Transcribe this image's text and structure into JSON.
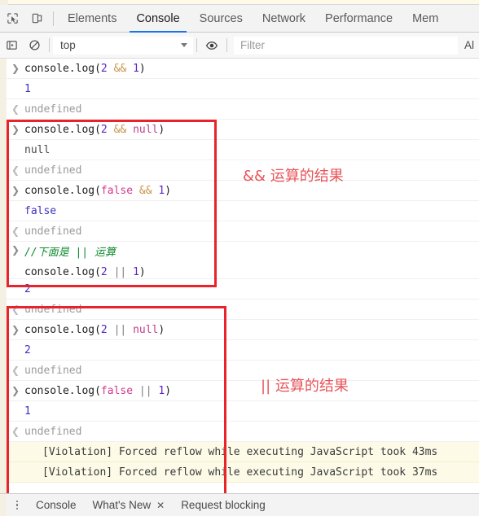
{
  "devtools": {
    "tabs": [
      {
        "label": "Elements",
        "active": false
      },
      {
        "label": "Console",
        "active": true
      },
      {
        "label": "Sources",
        "active": false
      },
      {
        "label": "Network",
        "active": false
      },
      {
        "label": "Performance",
        "active": false
      },
      {
        "label": "Mem",
        "active": false
      }
    ],
    "icons": {
      "inspect": "inspect-element-icon",
      "device": "device-toolbar-icon"
    }
  },
  "console_toolbar": {
    "sidebar_icon": "console-sidebar-icon",
    "clear_icon": "clear-console-icon",
    "context": "top",
    "eye_icon": "live-expression-eye-icon",
    "filter_placeholder": "Filter",
    "level": "Al"
  },
  "console_rows": [
    {
      "kind": "input",
      "prompt": ">",
      "html": "console.log(<span class=\"num\">2</span> <span class=\"op-amp\">&amp;&amp;</span> <span class=\"num\">1</span>)"
    },
    {
      "kind": "output",
      "prompt": "",
      "html": "<span class=\"val-blue\">1</span>"
    },
    {
      "kind": "return",
      "prompt": "<",
      "html": "<span class=\"ret-text\">undefined</span>"
    },
    {
      "kind": "input",
      "prompt": ">",
      "html": "console.log(<span class=\"num\">2</span> <span class=\"op-amp\">&amp;&amp;</span> <span class=\"kw-null\">null</span>)"
    },
    {
      "kind": "output",
      "prompt": "",
      "html": "<span class=\"val-gray\">null</span>"
    },
    {
      "kind": "return",
      "prompt": "<",
      "html": "<span class=\"ret-text\">undefined</span>"
    },
    {
      "kind": "input",
      "prompt": ">",
      "html": "console.log(<span class=\"kw-false\">false</span> <span class=\"op-amp\">&amp;&amp;</span> <span class=\"num\">1</span>)"
    },
    {
      "kind": "output",
      "prompt": "",
      "html": "<span class=\"val-blue\">false</span>"
    },
    {
      "kind": "return",
      "prompt": "<",
      "html": "<span class=\"ret-text\">undefined</span>"
    },
    {
      "kind": "input-multiline",
      "prompt": ">",
      "html": "<span class=\"comment\">//下面是 || 运算</span>",
      "html2": "console.log(<span class=\"num\">2</span> <span class=\"op-or\">||</span> <span class=\"num\">1</span>)"
    },
    {
      "kind": "output",
      "prompt": "",
      "html": "<span class=\"val-blue\">2</span>"
    },
    {
      "kind": "return",
      "prompt": "<",
      "html": "<span class=\"ret-text\">undefined</span>"
    },
    {
      "kind": "input",
      "prompt": ">",
      "html": "console.log(<span class=\"num\">2</span> <span class=\"op-or\">||</span> <span class=\"kw-null\">null</span>)"
    },
    {
      "kind": "output",
      "prompt": "",
      "html": "<span class=\"val-blue\">2</span>"
    },
    {
      "kind": "return",
      "prompt": "<",
      "html": "<span class=\"ret-text\">undefined</span>"
    },
    {
      "kind": "input",
      "prompt": ">",
      "html": "console.log(<span class=\"kw-false\">false</span> <span class=\"op-or\">||</span> <span class=\"num\">1</span>)"
    },
    {
      "kind": "output",
      "prompt": "",
      "html": "<span class=\"val-blue\">1</span>"
    },
    {
      "kind": "return",
      "prompt": "<",
      "html": "<span class=\"ret-text\">undefined</span>"
    },
    {
      "kind": "warning",
      "prompt": "",
      "html": "[Violation] Forced reflow while executing JavaScript took 43ms"
    },
    {
      "kind": "warning",
      "prompt": "",
      "html": "[Violation] Forced reflow while executing JavaScript took 37ms"
    }
  ],
  "annotations": [
    {
      "id": "and",
      "text": "&& 运算的结果",
      "color": "#e8555b"
    },
    {
      "id": "or",
      "text": "|| 运算的结果",
      "color": "#e8555b"
    }
  ],
  "highlight_boxes": [
    {
      "id": "and",
      "color": "#e8242a"
    },
    {
      "id": "or",
      "color": "#e8242a"
    }
  ],
  "drawer": {
    "menu_icon": "more-options-icon",
    "tabs": [
      {
        "label": "Console",
        "closable": false
      },
      {
        "label": "What's New",
        "closable": true,
        "close": "✕"
      },
      {
        "label": "Request blocking",
        "closable": false
      }
    ]
  }
}
